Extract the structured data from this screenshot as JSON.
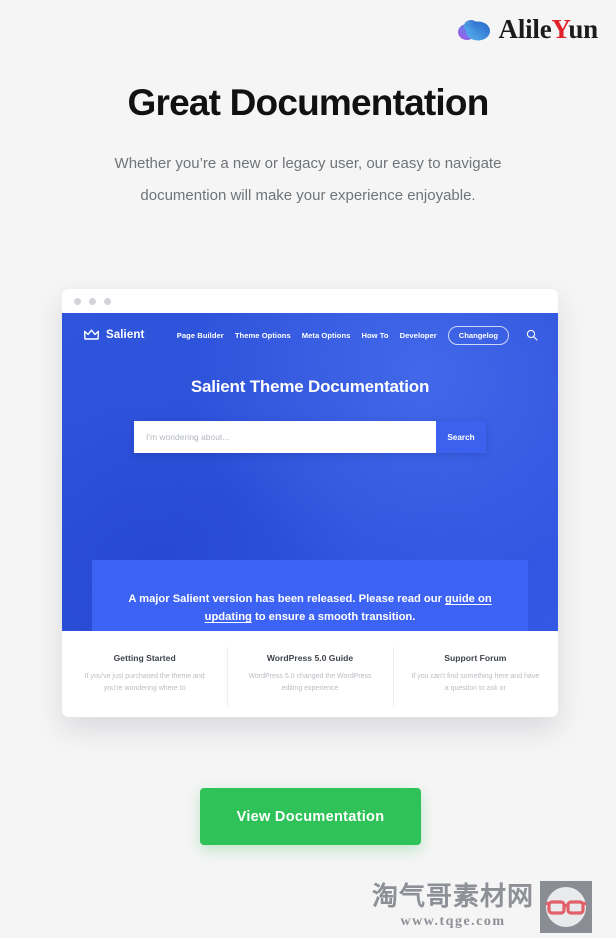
{
  "brand": {
    "name_part1": "Alile",
    "name_accent": "Y",
    "name_part2": "un",
    "logo_icon": "cloud-icon"
  },
  "hero_section": {
    "headline": "Great Documentation",
    "subheadline": "Whether you’re a new or legacy user, our easy to navigate documention will make your experience enjoyable."
  },
  "browser_mockup": {
    "window_dots": [
      "dot-1",
      "dot-2",
      "dot-3"
    ],
    "nav": {
      "logo_icon": "crown-icon",
      "logo_text": "Salient",
      "links": [
        {
          "label": "Page Builder"
        },
        {
          "label": "Theme Options"
        },
        {
          "label": "Meta Options"
        },
        {
          "label": "How To"
        },
        {
          "label": "Developer"
        }
      ],
      "pill_label": "Changelog",
      "search_icon": "search-icon"
    },
    "hero": {
      "title": "Salient Theme Documentation",
      "search_placeholder": "I'm wondering about...",
      "search_value": "",
      "search_button_label": "Search"
    },
    "banner": {
      "text_before": "A major Salient version has been released. Please read our ",
      "link_label": "guide on updating",
      "text_after": " to ensure a smooth transition."
    },
    "cards": [
      {
        "title": "Getting Started",
        "desc": "If you've just purchased the theme and you're wondering where to"
      },
      {
        "title": "WordPress 5.0 Guide",
        "desc": "WordPress 5.0 changed the WordPress editing experience"
      },
      {
        "title": "Support Forum",
        "desc": "If you can't find something here and have a question to ask or"
      }
    ]
  },
  "cta": {
    "label": "View Documentation"
  },
  "watermark": {
    "chinese_text": "淘气哥素材网",
    "url": "www.tqge.com",
    "badge_icon": "glasses-icon"
  },
  "colors": {
    "page_background": "#f5f5f5",
    "headline": "#111111",
    "subheadline": "#6f7479",
    "hero_blue": "#2f55dd",
    "banner_blue": "#3d63f5",
    "search_button_blue": "#3b61ee",
    "cta_green": "#2fc258",
    "brand_accent_red": "#e0202a",
    "watermark_gray": "#8d9096"
  }
}
